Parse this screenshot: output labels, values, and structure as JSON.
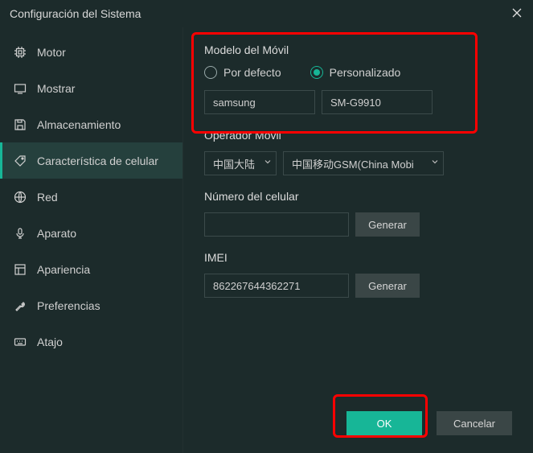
{
  "window": {
    "title": "Configuración del Sistema"
  },
  "sidebar": {
    "items": [
      {
        "label": "Motor"
      },
      {
        "label": "Mostrar"
      },
      {
        "label": "Almacenamiento"
      },
      {
        "label": "Característica de celular"
      },
      {
        "label": "Red"
      },
      {
        "label": "Aparato"
      },
      {
        "label": "Apariencia"
      },
      {
        "label": "Preferencias"
      },
      {
        "label": "Atajo"
      }
    ],
    "active_index": 3
  },
  "model_section": {
    "title": "Modelo del Móvil",
    "radio_default": "Por defecto",
    "radio_custom": "Personalizado",
    "selected": "custom",
    "brand_value": "samsung",
    "model_value": "SM-G9910"
  },
  "carrier_section": {
    "title": "Operador Móvil",
    "region_value": "中国大陆",
    "carrier_value": "中国移动GSM(China Mobi"
  },
  "phone_section": {
    "title": "Número del celular",
    "value": "",
    "generate_label": "Generar"
  },
  "imei_section": {
    "title": "IMEI",
    "value": "862267644362271",
    "generate_label": "Generar"
  },
  "footer": {
    "ok": "OK",
    "cancel": "Cancelar"
  }
}
